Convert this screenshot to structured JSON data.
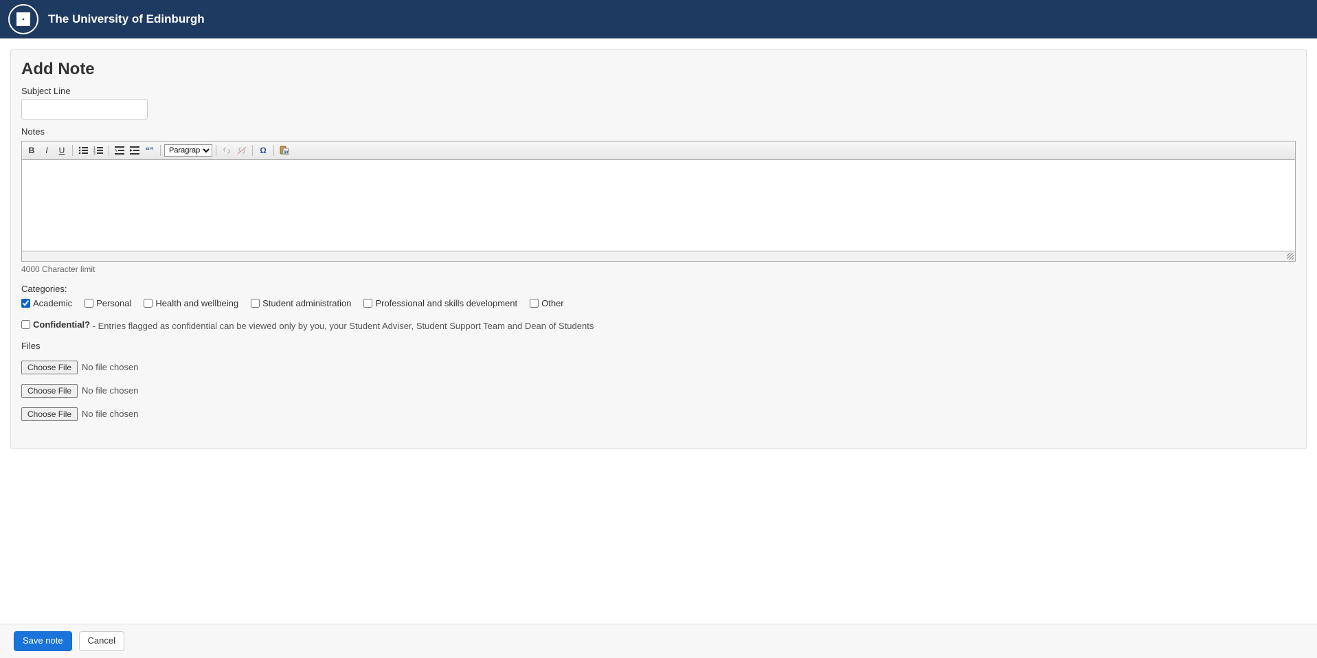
{
  "header": {
    "title": "The University of Edinburgh"
  },
  "page": {
    "title": "Add Note"
  },
  "form": {
    "subject_label": "Subject Line",
    "subject_value": "",
    "notes_label": "Notes",
    "char_limit": "4000 Character limit",
    "categories_label": "Categories:",
    "categories": [
      {
        "label": "Academic",
        "checked": true
      },
      {
        "label": "Personal",
        "checked": false
      },
      {
        "label": "Health and wellbeing",
        "checked": false
      },
      {
        "label": "Student administration",
        "checked": false
      },
      {
        "label": "Professional and skills development",
        "checked": false
      },
      {
        "label": "Other",
        "checked": false
      }
    ],
    "confidential_label": "Confidential?",
    "confidential_desc": " - Entries flagged as confidential can be viewed only by you, your Student Adviser, Student Support Team and Dean of Students",
    "files_label": "Files",
    "file_button": "Choose File",
    "file_state": "No file chosen",
    "file_slots": 3
  },
  "editor": {
    "format_value": "Paragraph"
  },
  "footer": {
    "save": "Save note",
    "cancel": "Cancel"
  }
}
